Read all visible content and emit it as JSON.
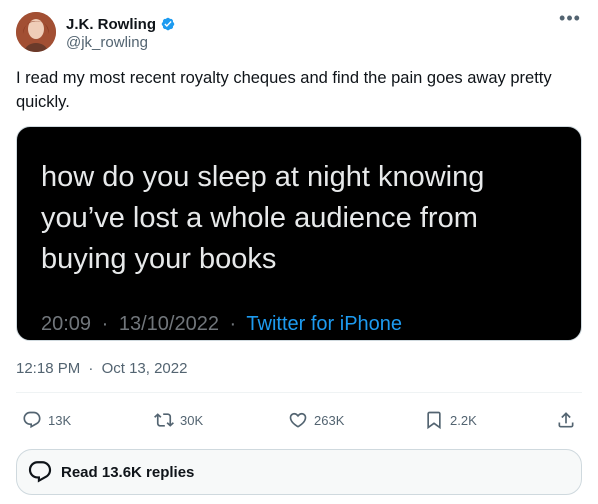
{
  "author": {
    "name": "J.K. Rowling",
    "handle": "@jk_rowling",
    "verified": true
  },
  "more_icon": "•••",
  "tweet": {
    "text": "I read my most recent royalty cheques and find the pain goes away pretty quickly."
  },
  "media": {
    "quote": "how do you sleep at night knowing you’ve lost a whole audience from buying your books",
    "time": "20:09",
    "separator": "·",
    "date": "13/10/2022",
    "source": "Twitter for iPhone"
  },
  "timestamp": {
    "time": "12:18 PM",
    "separator": "·",
    "date": "Oct 13, 2022"
  },
  "actions": {
    "replies": "13K",
    "retweets": "30K",
    "likes": "263K",
    "bookmarks": "2.2K"
  },
  "read_replies": "Read 13.6K replies",
  "colors": {
    "accent": "#1d9bf0",
    "text_primary": "#0f1419",
    "text_secondary": "#536471",
    "media_bg": "#000000"
  },
  "icons": [
    "verified-badge-icon",
    "more-icon",
    "reply-icon",
    "retweet-icon",
    "like-icon",
    "bookmark-icon",
    "share-icon",
    "replies-bubble-icon"
  ]
}
